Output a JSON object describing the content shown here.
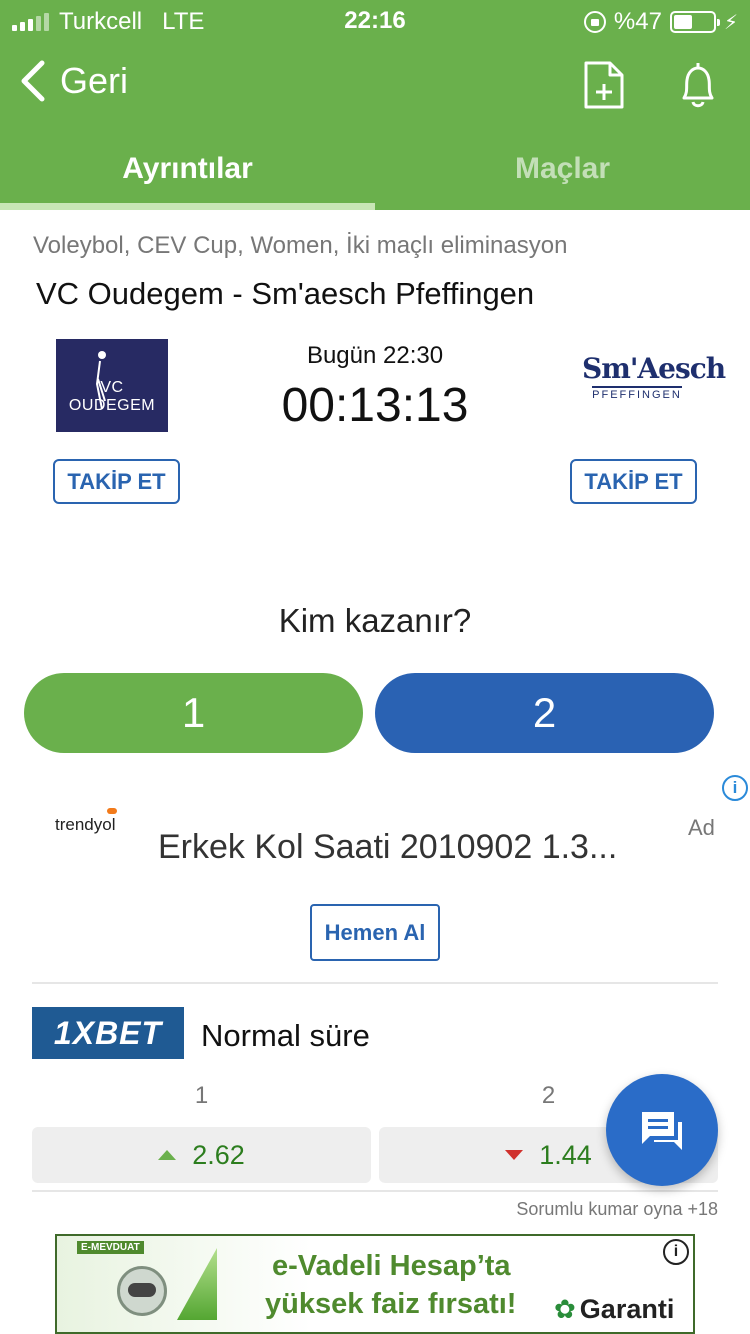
{
  "status_bar": {
    "carrier": "Turkcell",
    "network": "LTE",
    "time": "22:16",
    "battery_text": "%47",
    "battery_level": 0.47
  },
  "header": {
    "back_label": "Geri",
    "tabs": [
      {
        "label": "Ayrıntılar",
        "active": true
      },
      {
        "label": "Maçlar",
        "active": false
      }
    ],
    "colors": {
      "primary": "#6ab04c"
    }
  },
  "match": {
    "category": "Voleybol, CEV Cup, Women, İki maçlı eliminasyon",
    "title": "VC Oudegem - Sm'aesch Pfeffingen",
    "kickoff": "Bugün 22:30",
    "countdown": "00:13:13",
    "home": {
      "logo_text": "VC OUDEGEM",
      "follow_label": "TAKİP ET"
    },
    "away": {
      "logo_text": "Sm'Aesch",
      "logo_subtext": "PFEFFINGEN",
      "follow_label": "TAKİP ET"
    }
  },
  "poll": {
    "question": "Kim kazanır?",
    "options": [
      "1",
      "2"
    ]
  },
  "ad": {
    "label": "Ad",
    "brand": "trendyol",
    "title": "Erkek Kol Saati 2010902 1.3...",
    "cta": "Hemen Al"
  },
  "odds": {
    "bookmaker": "1XBET",
    "market": "Normal süre",
    "columns": [
      {
        "header": "1",
        "value": "2.62",
        "trend": "up"
      },
      {
        "header": "2",
        "value": "1.44",
        "trend": "down"
      }
    ],
    "disclaimer": "Sorumlu kumar oyna +18"
  },
  "banner": {
    "tag": "E-MEVDUAT",
    "line1": "e-Vadeli Hesap’ta",
    "line2": "yüksek faiz fırsatı!",
    "brand": "Garanti"
  }
}
